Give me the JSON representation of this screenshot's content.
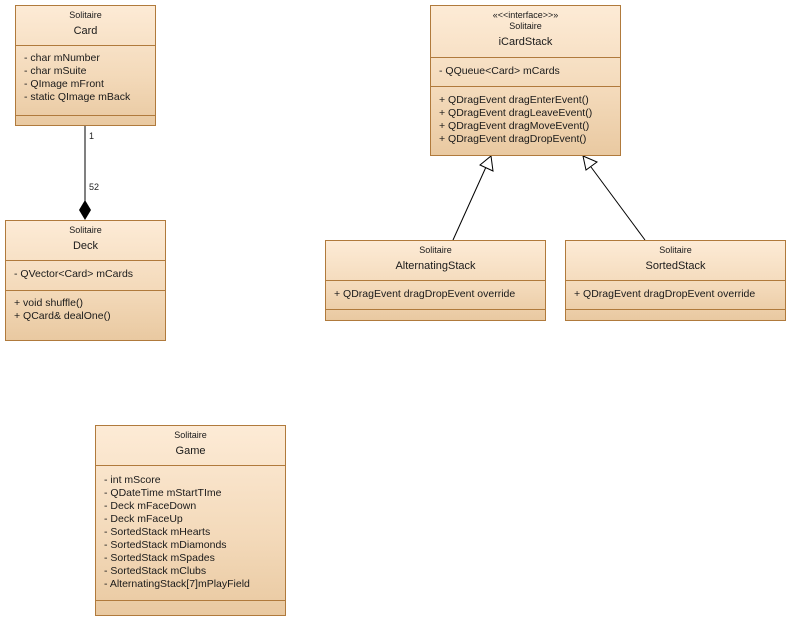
{
  "diagram": {
    "type": "uml-class-diagram",
    "colors": {
      "fill_top": "#fdebd6",
      "fill_bottom": "#e9c9a1",
      "border": "#b07a3c",
      "line": "#000000"
    },
    "classes": {
      "card": {
        "package": "Solitaire",
        "name": "Card",
        "attributes": [
          "- char mNumber",
          "- char mSuite",
          "- QImage mFront",
          "- static QImage mBack"
        ],
        "operations": []
      },
      "deck": {
        "package": "Solitaire",
        "name": "Deck",
        "attributes": [
          "- QVector<Card> mCards"
        ],
        "operations": [
          "+ void shuffle()",
          "+ QCard& dealOne()"
        ]
      },
      "icardstack": {
        "stereotype": "«<<interface>>»",
        "package": "Solitaire",
        "name": "iCardStack",
        "attributes": [
          "- QQueue<Card> mCards"
        ],
        "operations": [
          "+ QDragEvent dragEnterEvent()",
          "+ QDragEvent dragLeaveEvent()",
          "+ QDragEvent dragMoveEvent()",
          "+ QDragEvent dragDropEvent()"
        ]
      },
      "alternatingstack": {
        "package": "Solitaire",
        "name": "AlternatingStack",
        "attributes": [
          "+ QDragEvent dragDropEvent override"
        ],
        "operations": []
      },
      "sortedstack": {
        "package": "Solitaire",
        "name": "SortedStack",
        "attributes": [
          "+ QDragEvent dragDropEvent override"
        ],
        "operations": []
      },
      "game": {
        "package": "Solitaire",
        "name": "Game",
        "attributes": [
          "- int mScore",
          "- QDateTime mStartTIme",
          "- Deck mFaceDown",
          "- Deck mFaceUp",
          "- SortedStack mHearts",
          "- SortedStack mDiamonds",
          "- SortedStack mSpades",
          "- SortedStack mClubs",
          "- AlternatingStack[7]mPlayField"
        ],
        "operations": []
      }
    },
    "relationships": [
      {
        "type": "composition",
        "from": "Card",
        "to": "Deck",
        "multiplicity_source": "1",
        "multiplicity_target": "52"
      },
      {
        "type": "generalization",
        "from": "AlternatingStack",
        "to": "iCardStack"
      },
      {
        "type": "generalization",
        "from": "SortedStack",
        "to": "iCardStack"
      }
    ]
  }
}
